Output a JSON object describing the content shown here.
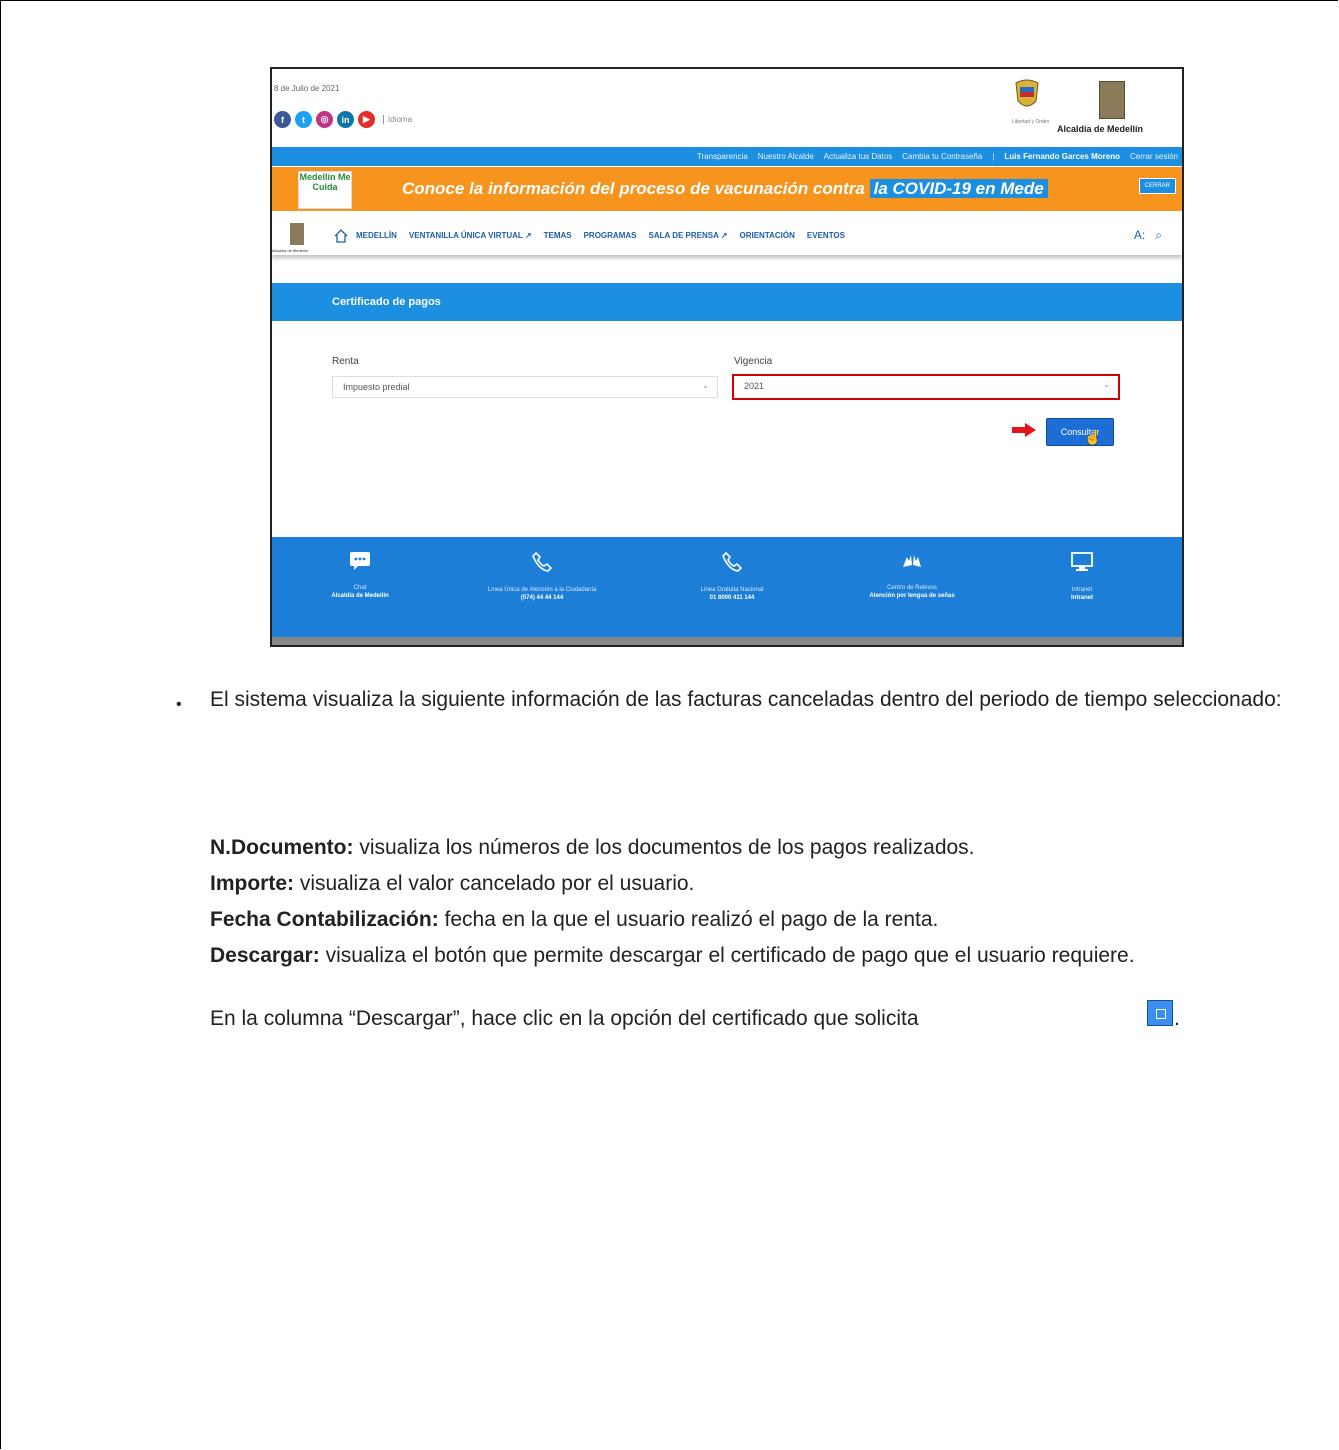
{
  "screenshot": {
    "date": "8 de Julio de 2021",
    "socials": [
      {
        "name": "facebook-icon",
        "glyph": "f",
        "color": "#3b5998"
      },
      {
        "name": "twitter-icon",
        "glyph": "t",
        "color": "#1da1f2"
      },
      {
        "name": "instagram-icon",
        "glyph": "◎",
        "color": "#c13584"
      },
      {
        "name": "linkedin-icon",
        "glyph": "in",
        "color": "#0e76a8"
      },
      {
        "name": "youtube-icon",
        "glyph": "▶",
        "color": "#e52d27"
      }
    ],
    "idioma": "Idioma",
    "escudo_text": "Libertad y Orden",
    "alcaldia": "Alcaldía de Medellín",
    "topnav": {
      "links": [
        "Transparencia",
        "Nuestro Alcalde",
        "Actualiza tus Datos",
        "Cambia tu Contraseña"
      ],
      "user": "Luis Fernando Garces Moreno",
      "logout": "Cerrar sesión"
    },
    "banner": {
      "logo": "Medellín Me Cuida",
      "text": "Conoce la información del proceso de vacunación contra ",
      "highlight": "la COVID-19 en Mede",
      "close": "CERRAR"
    },
    "nav": {
      "logo_text": "Alcaldía de Medellín",
      "items": [
        "MEDELLÍN",
        "VENTANILLA ÚNICA VIRTUAL ↗",
        "TEMAS",
        "PROGRAMAS",
        "SALA DE PRENSA ↗",
        "ORIENTACIÓN",
        "EVENTOS"
      ],
      "font_tool": "A:",
      "search_tool": "⌕"
    },
    "form": {
      "title": "Certificado de pagos",
      "renta_label": "Renta",
      "renta_value": "Impuesto predial",
      "vigencia_label": "Vigencia",
      "vigencia_value": "2021",
      "button": "Consultar"
    },
    "footer": [
      {
        "l1": "Chat",
        "l2": "Alcaldía de Medellín"
      },
      {
        "l1": "Línea Única de Atención a la Ciudadanía",
        "l2": "(574) 44 44 144"
      },
      {
        "l1": "Línea Gratuita Nacional",
        "l2": "01 8000 411 144"
      },
      {
        "l1": "Centro de Relevos",
        "l2": "Atención por lengua de señas"
      },
      {
        "l1": "Intranet",
        "l2": "Intranet"
      }
    ]
  },
  "document": {
    "bullet": "•",
    "paragraph": "El sistema visualiza la siguiente información de las facturas canceladas dentro del periodo de tiempo seleccionado:",
    "definitions": [
      {
        "term": "N.Documento:",
        "text": " visualiza los números de los documentos de los pagos realizados."
      },
      {
        "term": "Importe:",
        "text": " visualiza el valor cancelado por el usuario."
      },
      {
        "term": "Fecha Contabilización:",
        "text": " fecha en la que el usuario realizó el pago de la renta."
      },
      {
        "term": "Descargar:",
        "text": " visualiza el botón que permite descargar el certificado de pago que el usuario requiere."
      }
    ],
    "instruction": "En la columna “Descargar”, hace clic en la opción del certificado que solicita",
    "instruction_end": "."
  }
}
